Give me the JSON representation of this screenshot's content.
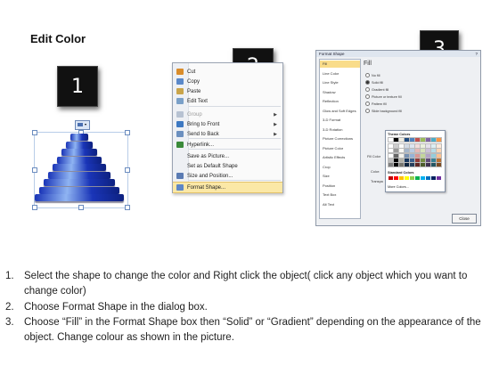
{
  "title": "Edit Color",
  "badges": [
    "1",
    "2",
    "3"
  ],
  "pyramid_colors": {
    "dark": "#1a35b8",
    "light": "#8fb4f2"
  },
  "context_menu": {
    "items": [
      {
        "label": "Cut",
        "icon": "scissors-icon",
        "enabled": true
      },
      {
        "label": "Copy",
        "icon": "copy-icon",
        "enabled": true
      },
      {
        "label": "Paste",
        "icon": "paste-icon",
        "enabled": true
      },
      {
        "label": "Edit Text",
        "icon": "edit-text-icon",
        "enabled": true
      },
      {
        "label": "Group",
        "icon": "group-icon",
        "enabled": false,
        "submenu": true
      },
      {
        "label": "Bring to Front",
        "icon": "bring-front-icon",
        "enabled": true,
        "submenu": true
      },
      {
        "label": "Send to Back",
        "icon": "send-back-icon",
        "enabled": true,
        "submenu": true
      },
      {
        "label": "Hyperlink...",
        "icon": "hyperlink-icon",
        "enabled": true
      },
      {
        "label": "Save as Picture...",
        "icon": "",
        "enabled": true
      },
      {
        "label": "Set as Default Shape",
        "icon": "",
        "enabled": true
      },
      {
        "label": "Size and Position...",
        "icon": "size-position-icon",
        "enabled": true
      },
      {
        "label": "Format Shape...",
        "icon": "format-shape-icon",
        "enabled": true,
        "highlighted": true
      }
    ]
  },
  "format_dialog": {
    "title": "Format Shape",
    "close_glyph": "?",
    "categories": [
      "Fill",
      "Line Color",
      "Line Style",
      "Shadow",
      "Reflection",
      "Glow and Soft Edges",
      "3-D Format",
      "3-D Rotation",
      "Picture Corrections",
      "Picture Color",
      "Artistic Effects",
      "Crop",
      "Size",
      "Position",
      "Text Box",
      "Alt Text"
    ],
    "selected_category": "Fill",
    "pane_heading": "Fill",
    "fill_options": [
      {
        "label": "No fill",
        "selected": false
      },
      {
        "label": "Solid fill",
        "selected": true
      },
      {
        "label": "Gradient fill",
        "selected": false
      },
      {
        "label": "Picture or texture fill",
        "selected": false
      },
      {
        "label": "Pattern fill",
        "selected": false
      },
      {
        "label": "Slide background fill",
        "selected": false
      }
    ],
    "fill_color_label": "Fill Color",
    "color_label": "Color:",
    "transparency_label": "Transpa",
    "close_button": "Close",
    "palette": {
      "theme_title": "Theme Colors",
      "standard_title": "Standard Colors",
      "more_colors": "More Colors...",
      "theme_colors": [
        "#ffffff",
        "#000000",
        "#eeece1",
        "#1f497d",
        "#4f81bd",
        "#c0504d",
        "#9bbb59",
        "#8064a2",
        "#4bacc6",
        "#f79646"
      ],
      "standard_colors": [
        "#c00000",
        "#ff0000",
        "#ffc000",
        "#ffff00",
        "#92d050",
        "#00b050",
        "#00b0f0",
        "#0070c0",
        "#002060",
        "#7030a0"
      ]
    }
  },
  "instructions": [
    {
      "num": "1.",
      "text": "Select the shape to change the color and Right click the object( click any object which you want to change color)"
    },
    {
      "num": "2.",
      "text": "Choose Format Shape in the dialog box."
    },
    {
      "num": "3.",
      "text": "Choose “Fill” in the Format Shape box then “Solid” or “Gradient” depending on the appearance of the object. Change colour as shown in the picture."
    }
  ]
}
